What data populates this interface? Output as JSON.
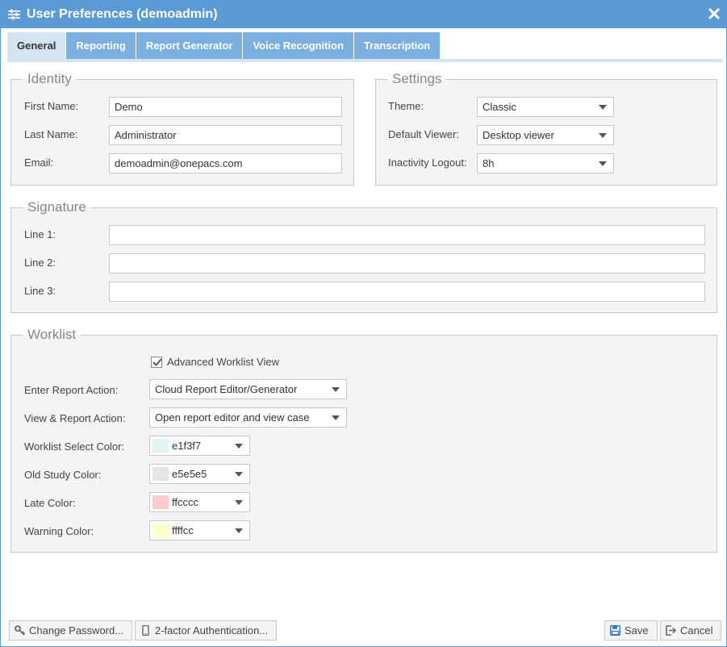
{
  "window": {
    "title": "User Preferences (demoadmin)",
    "title_color": "#5b9bd5"
  },
  "tabs": [
    {
      "label": "General",
      "active": true
    },
    {
      "label": "Reporting",
      "active": false
    },
    {
      "label": "Report Generator",
      "active": false
    },
    {
      "label": "Voice Recognition",
      "active": false
    },
    {
      "label": "Transcription",
      "active": false
    }
  ],
  "identity": {
    "legend": "Identity",
    "first_name_label": "First Name:",
    "first_name_value": "Demo",
    "last_name_label": "Last Name:",
    "last_name_value": "Administrator",
    "email_label": "Email:",
    "email_value": "demoadmin@onepacs.com"
  },
  "settings": {
    "legend": "Settings",
    "theme_label": "Theme:",
    "theme_value": "Classic",
    "viewer_label": "Default Viewer:",
    "viewer_value": "Desktop viewer",
    "logout_label": "Inactivity Logout:",
    "logout_value": "8h"
  },
  "signature": {
    "legend": "Signature",
    "line1_label": "Line 1:",
    "line1_value": "",
    "line2_label": "Line 2:",
    "line2_value": "",
    "line3_label": "Line 3:",
    "line3_value": ""
  },
  "worklist": {
    "legend": "Worklist",
    "advanced_label": "Advanced Worklist View",
    "advanced_checked": true,
    "enter_action_label": "Enter Report Action:",
    "enter_action_value": "Cloud Report Editor/Generator",
    "view_action_label": "View & Report Action:",
    "view_action_value": "Open report editor and view case",
    "select_color_label": "Worklist Select Color:",
    "select_color_value": "e1f3f7",
    "old_color_label": "Old Study Color:",
    "old_color_value": "e5e5e5",
    "late_color_label": "Late Color:",
    "late_color_value": "ffcccc",
    "warning_color_label": "Warning Color:",
    "warning_color_value": "ffffcc"
  },
  "footer": {
    "change_password_label": "Change Password...",
    "two_factor_label": "2-factor Authentication...",
    "save_label": "Save",
    "cancel_label": "Cancel"
  }
}
